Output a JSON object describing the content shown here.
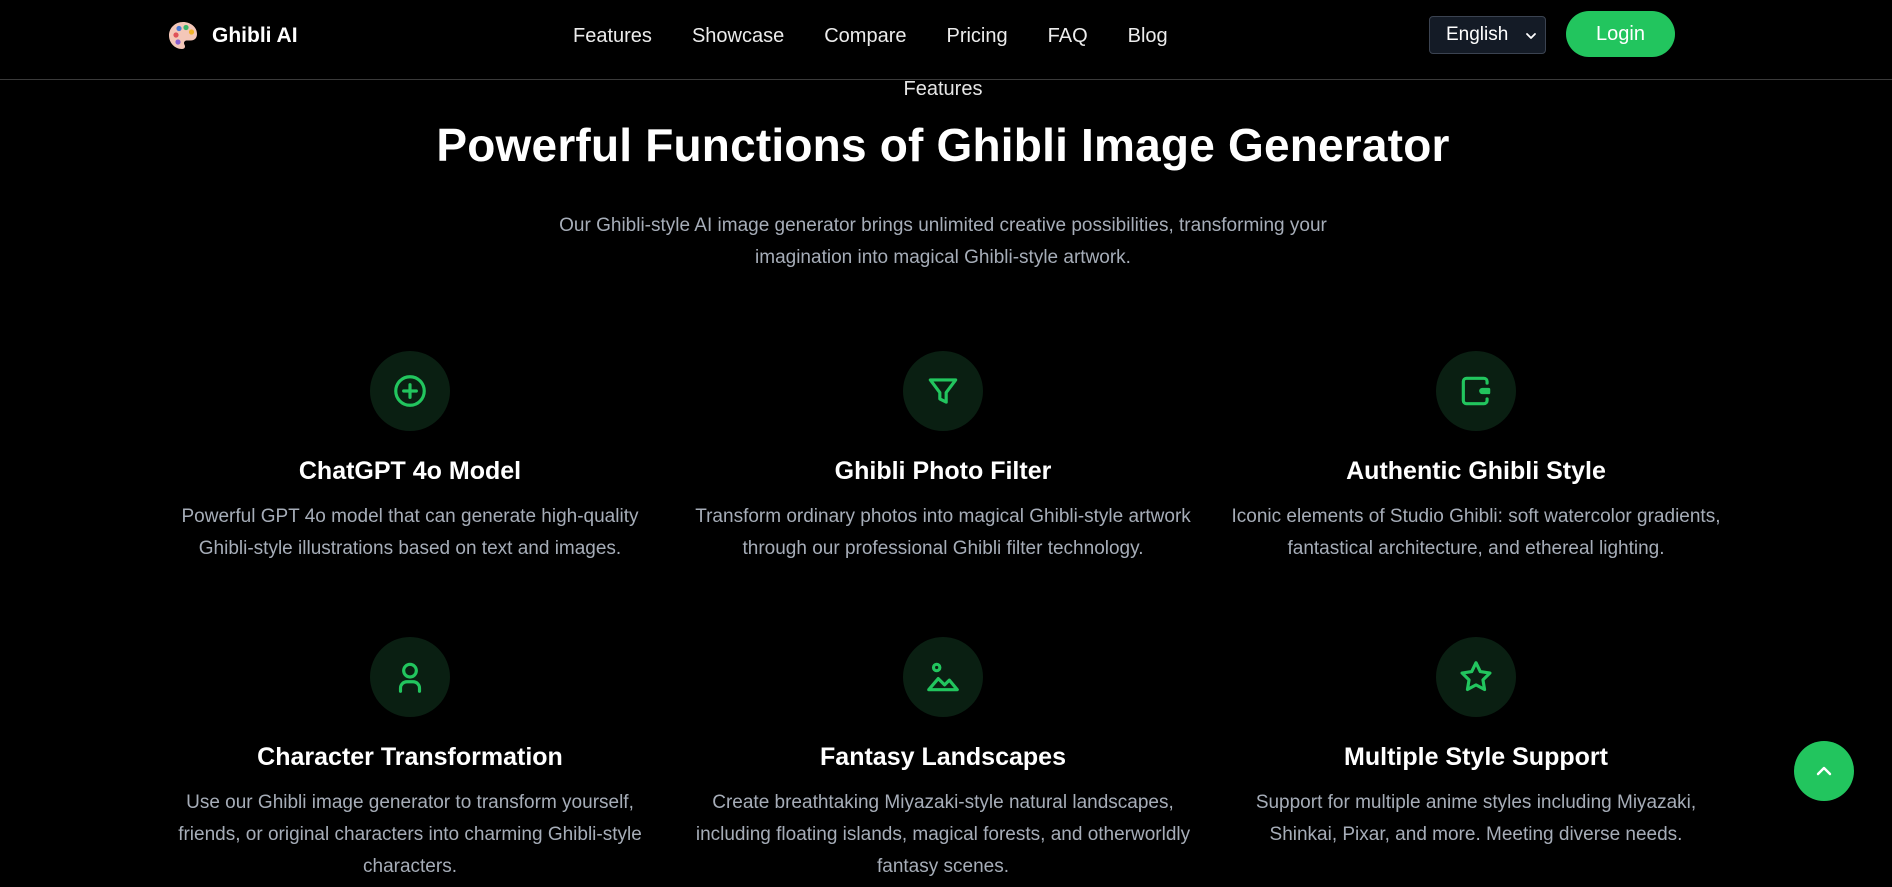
{
  "header": {
    "brand_name": "Ghibli AI",
    "nav": [
      "Features",
      "Showcase",
      "Compare",
      "Pricing",
      "FAQ",
      "Blog"
    ],
    "language_selected": "English",
    "login_label": "Login"
  },
  "section": {
    "eyebrow": "Features",
    "title": "Powerful Functions of Ghibli Image Generator",
    "subtitle": "Our Ghibli-style AI image generator brings unlimited creative possibilities, transforming your imagination into magical Ghibli-style artwork."
  },
  "features": [
    {
      "icon": "plus-circle-icon",
      "title": "ChatGPT 4o Model",
      "description": "Powerful GPT 4o model that can generate high-quality Ghibli-style illustrations based on text and images."
    },
    {
      "icon": "filter-icon",
      "title": "Ghibli Photo Filter",
      "description": "Transform ordinary photos into magical Ghibli-style artwork through our professional Ghibli filter technology."
    },
    {
      "icon": "wallet-icon",
      "title": "Authentic Ghibli Style",
      "description": "Iconic elements of Studio Ghibli: soft watercolor gradients, fantastical architecture, and ethereal lighting."
    },
    {
      "icon": "user-icon",
      "title": "Character Transformation",
      "description": "Use our Ghibli image generator to transform yourself, friends, or original characters into charming Ghibli-style characters."
    },
    {
      "icon": "landscape-icon",
      "title": "Fantasy Landscapes",
      "description": "Create breathtaking Miyazaki-style natural landscapes, including floating islands, magical forests, and otherworldly fantasy scenes."
    },
    {
      "icon": "star-icon",
      "title": "Multiple Style Support",
      "description": "Support for multiple anime styles including Miyazaki, Shinkai, Pixar, and more. Meeting diverse needs."
    }
  ],
  "colors": {
    "accent": "#22c55e",
    "icon_bg": "#0a1f12",
    "background": "#000000",
    "muted_text": "#a6adb8"
  }
}
